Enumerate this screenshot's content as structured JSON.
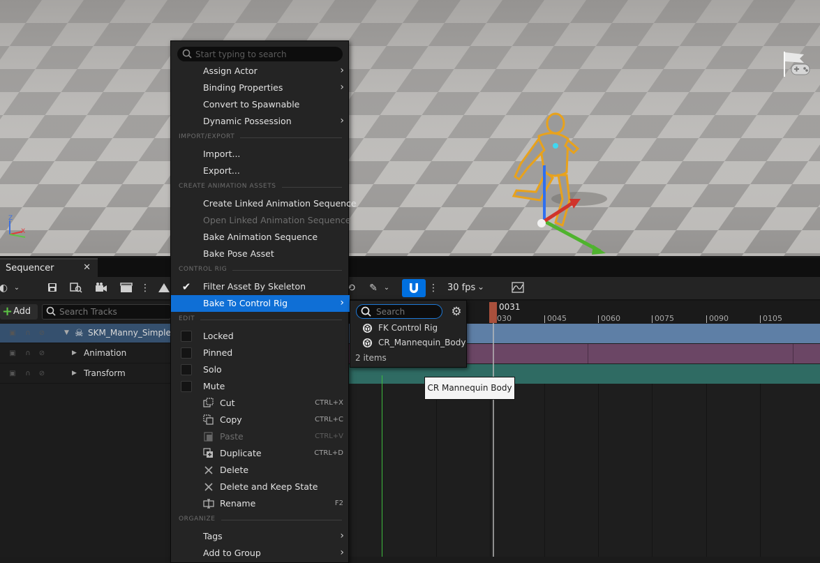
{
  "viewport": {
    "axis_labels": {
      "z": "Z",
      "x": "X"
    },
    "game_mode_icon": "game-controller-flag-icon"
  },
  "sequencer": {
    "tab_label": "Sequencer",
    "tab_close": "✕",
    "toolbar": {
      "fps": "30 fps",
      "icons": [
        "globe-icon",
        "save-icon",
        "find-icon",
        "camera-icon",
        "clapper-icon",
        "more-icon",
        "render-icon",
        "transform-icon",
        "brush-icon",
        "magnet-icon",
        "snap-options-icon",
        "curve-editor-icon"
      ]
    },
    "add_label": "Add",
    "search_tracks_placeholder": "Search Tracks",
    "tracks": [
      {
        "name": "SKM_Manny_Simple"
      },
      {
        "name": "Animation"
      },
      {
        "name": "Transform"
      }
    ],
    "timeline": {
      "playhead": "0031",
      "ticks": [
        "0030",
        "0045",
        "0060",
        "0075",
        "0090",
        "0105"
      ]
    }
  },
  "context_menu": {
    "search_placeholder": "Start typing to search",
    "items_top": [
      {
        "label": "Assign Actor",
        "submenu": true
      },
      {
        "label": "Binding Properties",
        "submenu": true
      },
      {
        "label": "Convert to Spawnable",
        "submenu": false
      },
      {
        "label": "Dynamic Possession",
        "submenu": true
      }
    ],
    "sections": {
      "import_export": "IMPORT/EXPORT",
      "create_animation_assets": "CREATE ANIMATION ASSETS",
      "control_rig": "CONTROL RIG",
      "edit": "EDIT",
      "organize": "ORGANIZE"
    },
    "import_export": [
      {
        "label": "Import..."
      },
      {
        "label": "Export..."
      }
    ],
    "animation_assets": [
      {
        "label": "Create Linked Animation Sequence",
        "disabled": false
      },
      {
        "label": "Open Linked Animation Sequence",
        "disabled": true
      },
      {
        "label": "Bake Animation Sequence",
        "disabled": false
      },
      {
        "label": "Bake Pose Asset",
        "disabled": false
      }
    ],
    "control_rig": {
      "filter_label": "Filter Asset By Skeleton",
      "filter_checked": true,
      "bake_label": "Bake To Control Rig"
    },
    "edit_toggles": [
      {
        "label": "Locked"
      },
      {
        "label": "Pinned"
      },
      {
        "label": "Solo"
      },
      {
        "label": "Mute"
      }
    ],
    "edit_actions": [
      {
        "label": "Cut",
        "shortcut": "CTRL+X",
        "disabled": false,
        "icon": "cut-icon"
      },
      {
        "label": "Copy",
        "shortcut": "CTRL+C",
        "disabled": false,
        "icon": "copy-icon"
      },
      {
        "label": "Paste",
        "shortcut": "CTRL+V",
        "disabled": true,
        "icon": "paste-icon"
      },
      {
        "label": "Duplicate",
        "shortcut": "CTRL+D",
        "disabled": false,
        "icon": "duplicate-icon"
      },
      {
        "label": "Delete",
        "shortcut": "",
        "disabled": false,
        "icon": "delete-icon"
      },
      {
        "label": "Delete and Keep State",
        "shortcut": "",
        "disabled": false,
        "icon": "delete-keep-state-icon"
      },
      {
        "label": "Rename",
        "shortcut": "F2",
        "disabled": false,
        "icon": "rename-icon"
      }
    ],
    "organize": [
      {
        "label": "Tags"
      },
      {
        "label": "Add to Group"
      }
    ]
  },
  "submenu": {
    "search_placeholder": "Search",
    "items": [
      {
        "label": "FK Control Rig"
      },
      {
        "label": "CR_Mannequin_Body"
      }
    ],
    "count": "2 items"
  },
  "tooltip": {
    "text": "CR Mannequin Body"
  },
  "colors": {
    "highlight": "#0f6fd6",
    "lane_mesh": "#5e7fa6",
    "lane_animation": "#6b4665",
    "lane_transform": "#2f6b63",
    "playhead": "#a9503c"
  }
}
